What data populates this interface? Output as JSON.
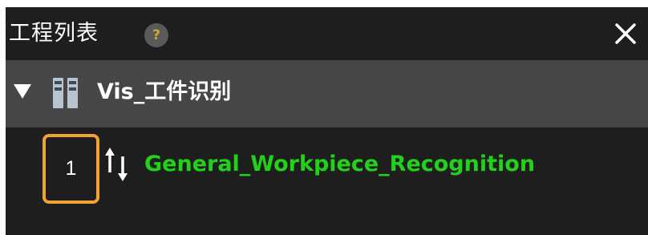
{
  "panel": {
    "title": "工程列表",
    "help_glyph": "?",
    "close_icon": "close-icon"
  },
  "project": {
    "name": "Vis_工件识别",
    "expand_icon": "caret-down-icon",
    "type_icon": "project-columns-icon"
  },
  "steps": [
    {
      "index": "1",
      "io_icon": "up-down-arrows-icon",
      "name": "General_Workpiece_Recognition",
      "name_color": "#22d11a"
    }
  ],
  "colors": {
    "panel_bg": "#1e1e1e",
    "project_row_bg": "#464646",
    "highlight_border": "#f0a430"
  }
}
